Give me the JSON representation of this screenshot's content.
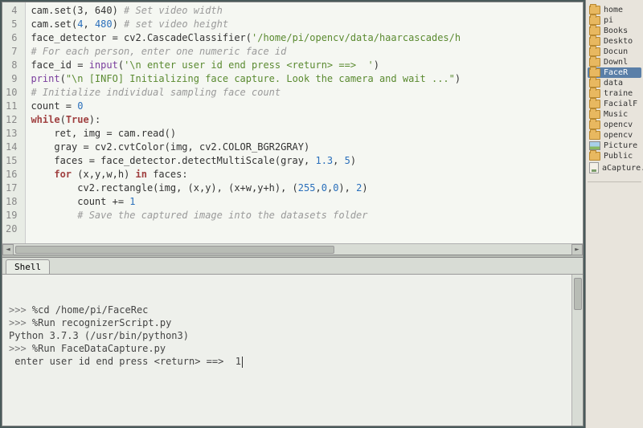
{
  "editor": {
    "line_start": 4,
    "lines": [
      {
        "n": 4,
        "html": "cam.set(3, 640) <span class='com'># Set video width</span>"
      },
      {
        "n": 5,
        "html": "cam.set(<span class='num'>4</span>, <span class='num'>480</span>) <span class='com'># set video height</span>"
      },
      {
        "n": 6,
        "html": "face_detector = cv2.CascadeClassifier(<span class='str'>'/home/pi/opencv/data/haarcascades/h</span>"
      },
      {
        "n": 7,
        "html": "<span class='com'># For each person, enter one numeric face id</span>"
      },
      {
        "n": 8,
        "html": "face_id = <span class='bi'>input</span>(<span class='str'>'\\n enter user id end press &lt;return&gt; ==&gt;  '</span>)"
      },
      {
        "n": 9,
        "html": "<span class='bi'>print</span>(<span class='str'>\"\\n [INFO] Initializing face capture. Look the camera and wait ...\"</span>)"
      },
      {
        "n": 10,
        "html": "<span class='com'># Initialize individual sampling face count</span>"
      },
      {
        "n": 11,
        "html": "count = <span class='num'>0</span>"
      },
      {
        "n": 12,
        "html": "<span class='kw'>while</span>(<span class='kw'>True</span>):"
      },
      {
        "n": 13,
        "html": "    ret, img = cam.read()"
      },
      {
        "n": 14,
        "html": ""
      },
      {
        "n": 15,
        "html": "    gray = cv2.cvtColor(img, cv2.COLOR_BGR2GRAY)"
      },
      {
        "n": 16,
        "html": "    faces = face_detector.detectMultiScale(gray, <span class='num'>1.3</span>, <span class='num'>5</span>)"
      },
      {
        "n": 17,
        "html": "    <span class='kw'>for</span> (x,y,w,h) <span class='kw'>in</span> faces:"
      },
      {
        "n": 18,
        "html": "        cv2.rectangle(img, (x,y), (x+w,y+h), (<span class='num'>255</span>,<span class='num'>0</span>,<span class='num'>0</span>), <span class='num'>2</span>)"
      },
      {
        "n": 19,
        "html": "        count += <span class='num'>1</span>"
      },
      {
        "n": 20,
        "html": "        <span class='com'># Save the captured image into the datasets folder</span>"
      }
    ]
  },
  "shell": {
    "tab_label": "Shell",
    "history": [
      {
        "prompt": ">>> ",
        "text": "%cd /home/pi/FaceRec"
      },
      {
        "prompt": ">>> ",
        "text": "%Run recognizerScript.py"
      },
      {
        "prompt": "",
        "text": ""
      },
      {
        "prompt": "",
        "text": ""
      },
      {
        "prompt": "",
        "text": "Python 3.7.3 (/usr/bin/python3)"
      },
      {
        "prompt": ">>> ",
        "text": "%Run FaceDataCapture.py"
      },
      {
        "prompt": "",
        "text": ""
      },
      {
        "prompt": "",
        "text": " enter user id end press <return> ==>  1"
      }
    ]
  },
  "filemgr": {
    "items": [
      {
        "type": "folder",
        "label": "home",
        "selected": false
      },
      {
        "type": "folder",
        "label": "pi",
        "selected": false
      },
      {
        "type": "folder",
        "label": "Books",
        "selected": false
      },
      {
        "type": "folder",
        "label": "Deskto",
        "selected": false
      },
      {
        "type": "folder",
        "label": "Docun",
        "selected": false
      },
      {
        "type": "folder",
        "label": "Downl",
        "selected": false
      },
      {
        "type": "folder",
        "label": "FaceR",
        "selected": true
      },
      {
        "type": "folder",
        "label": "data",
        "selected": false
      },
      {
        "type": "folder",
        "label": "traine",
        "selected": false
      },
      {
        "type": "folder",
        "label": "FacialF",
        "selected": false
      },
      {
        "type": "folder",
        "label": "Music",
        "selected": false
      },
      {
        "type": "folder",
        "label": "opencv",
        "selected": false
      },
      {
        "type": "folder",
        "label": "opencv",
        "selected": false
      },
      {
        "type": "pic",
        "label": "Picture",
        "selected": false
      },
      {
        "type": "folder",
        "label": "Public",
        "selected": false
      },
      {
        "type": "file",
        "label": "aCapture.py",
        "selected": false
      }
    ]
  }
}
